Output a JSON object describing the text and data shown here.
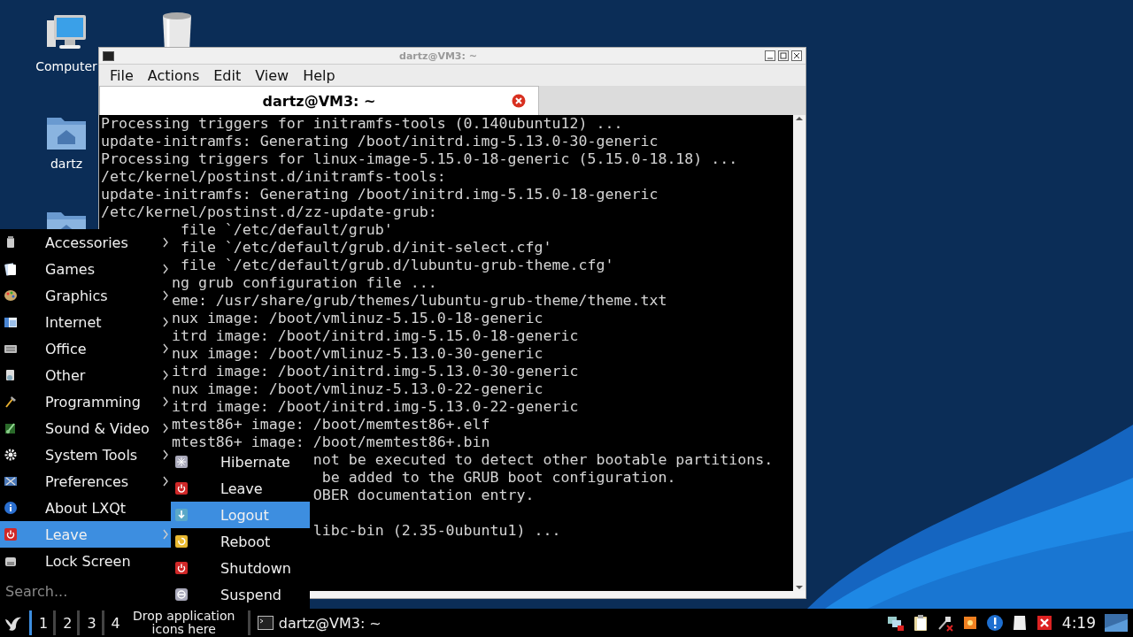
{
  "desktop": {
    "icons": [
      {
        "kind": "computer",
        "label": "Computer"
      },
      {
        "kind": "trash"
      },
      {
        "kind": "home",
        "label": "dartz"
      },
      {
        "kind": "folder"
      }
    ]
  },
  "terminal": {
    "title": "dartz@VM3: ~",
    "menu": [
      "File",
      "Actions",
      "Edit",
      "View",
      "Help"
    ],
    "tabs": [
      {
        "label": "dartz@VM3: ~",
        "selected": true
      }
    ],
    "lines": [
      {
        "kind": "full",
        "text": "Processing triggers for initramfs-tools (0.140ubuntu12) ..."
      },
      {
        "kind": "full",
        "text": "update-initramfs: Generating /boot/initrd.img-5.13.0-30-generic"
      },
      {
        "kind": "full",
        "text": "Processing triggers for linux-image-5.15.0-18-generic (5.15.0-18.18) ..."
      },
      {
        "kind": "full",
        "text": "/etc/kernel/postinst.d/initramfs-tools:"
      },
      {
        "kind": "full",
        "text": "update-initramfs: Generating /boot/initrd.img-5.15.0-18-generic"
      },
      {
        "kind": "full",
        "text": "/etc/kernel/postinst.d/zz-update-grub:"
      },
      {
        "kind": "after-menu",
        "text": " file `/etc/default/grub'"
      },
      {
        "kind": "after-menu",
        "text": " file `/etc/default/grub.d/init-select.cfg'"
      },
      {
        "kind": "after-menu",
        "text": " file `/etc/default/grub.d/lubuntu-grub-theme.cfg'"
      },
      {
        "kind": "after-menu",
        "text": "ng grub configuration file ..."
      },
      {
        "kind": "after-menu",
        "text": "eme: /usr/share/grub/themes/lubuntu-grub-theme/theme.txt"
      },
      {
        "kind": "after-menu",
        "text": "nux image: /boot/vmlinuz-5.15.0-18-generic"
      },
      {
        "kind": "after-menu",
        "text": "itrd image: /boot/initrd.img-5.15.0-18-generic"
      },
      {
        "kind": "after-menu",
        "text": "nux image: /boot/vmlinuz-5.13.0-30-generic"
      },
      {
        "kind": "after-menu",
        "text": "itrd image: /boot/initrd.img-5.13.0-30-generic"
      },
      {
        "kind": "after-menu",
        "text": "nux image: /boot/vmlinuz-5.13.0-22-generic"
      },
      {
        "kind": "after-menu",
        "text": "itrd image: /boot/initrd.img-5.13.0-22-generic"
      },
      {
        "kind": "after-menu",
        "text": "mtest86+ image: /boot/memtest86+.elf"
      },
      {
        "kind": "after-menu",
        "text": "mtest86+ image: /boot/memtest86+.bin"
      },
      {
        "kind": "after-submenu",
        "text": "not be executed to detect other bootable partitions."
      },
      {
        "kind": "after-submenu",
        "text": " be added to the GRUB boot configuration."
      },
      {
        "kind": "after-submenu",
        "text": "OBER documentation entry."
      },
      {
        "kind": "blank"
      },
      {
        "kind": "after-submenu",
        "text": "libc-bin (2.35-0ubuntu1) ..."
      }
    ]
  },
  "start_menu": {
    "items": [
      {
        "kind": "accessories",
        "label": "Accessories",
        "submenu": true,
        "selected": false
      },
      {
        "kind": "games",
        "label": "Games",
        "submenu": true,
        "selected": false
      },
      {
        "kind": "graphics",
        "label": "Graphics",
        "submenu": true,
        "selected": false
      },
      {
        "kind": "internet",
        "label": "Internet",
        "submenu": true,
        "selected": false
      },
      {
        "kind": "office",
        "label": "Office",
        "submenu": true,
        "selected": false
      },
      {
        "kind": "other",
        "label": "Other",
        "submenu": true,
        "selected": false
      },
      {
        "kind": "programming",
        "label": "Programming",
        "submenu": true,
        "selected": false
      },
      {
        "kind": "sound",
        "label": "Sound & Video",
        "submenu": true,
        "selected": false
      },
      {
        "kind": "system",
        "label": "System Tools",
        "submenu": true,
        "selected": false
      },
      {
        "kind": "preferences",
        "label": "Preferences",
        "submenu": true,
        "selected": false
      },
      {
        "kind": "about",
        "label": "About LXQt",
        "submenu": false,
        "selected": false
      },
      {
        "kind": "power",
        "label": "Leave",
        "submenu": true,
        "selected": true
      },
      {
        "kind": "lock",
        "label": "Lock Screen",
        "submenu": false,
        "selected": false
      }
    ],
    "search": {
      "placeholder": "Search..."
    }
  },
  "leave_menu": {
    "items": [
      {
        "kind": "hibernate",
        "label": "Hibernate",
        "selected": false
      },
      {
        "kind": "power",
        "label": "Leave",
        "selected": false
      },
      {
        "kind": "logout",
        "label": "Logout",
        "selected": true
      },
      {
        "kind": "reboot",
        "label": "Reboot",
        "selected": false
      },
      {
        "kind": "power",
        "label": "Shutdown",
        "selected": false
      },
      {
        "kind": "suspend",
        "label": "Suspend",
        "selected": false
      }
    ]
  },
  "taskbar": {
    "desktops": [
      {
        "label": "1",
        "selected": true
      },
      {
        "label": "2",
        "selected": false
      },
      {
        "label": "3",
        "selected": false
      },
      {
        "label": "4",
        "selected": false
      }
    ],
    "launcher_hint": "Drop application icons here",
    "tasks": [
      {
        "label": "dartz@VM3: ~"
      }
    ],
    "tray": [
      {
        "kind": "network"
      },
      {
        "kind": "clipboard"
      },
      {
        "kind": "tool"
      },
      {
        "kind": "burst"
      },
      {
        "kind": "alert"
      },
      {
        "kind": "blank"
      },
      {
        "kind": "x"
      }
    ],
    "clock": "4:19"
  }
}
